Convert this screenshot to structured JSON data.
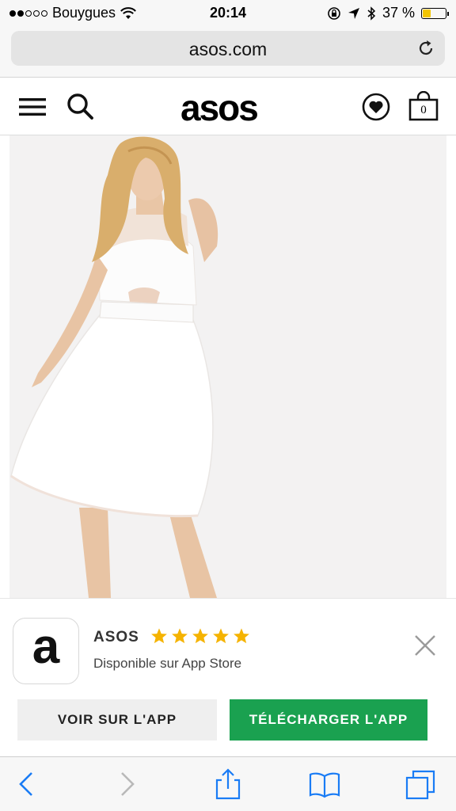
{
  "status_bar": {
    "carrier": "Bouygues",
    "time": "20:14",
    "battery_percent": "37 %",
    "battery_level": 0.37,
    "signal_bars": 2,
    "battery_color": "#f2c500"
  },
  "browser": {
    "url": "asos.com"
  },
  "site_header": {
    "logo": "asos",
    "bag_count": "0"
  },
  "product": {
    "image_description_icon": "product-photo"
  },
  "app_banner": {
    "icon_letter": "a",
    "app_name": "ASOS",
    "rating_stars": 5,
    "star_color": "#f5b301",
    "subtitle": "Disponible sur App Store",
    "view_button": "VOIR SUR L'APP",
    "download_button": "TÉLÉCHARGER L'APP",
    "download_color": "#1aa150"
  },
  "toolbar": {
    "accent": "#1a7cf5"
  }
}
